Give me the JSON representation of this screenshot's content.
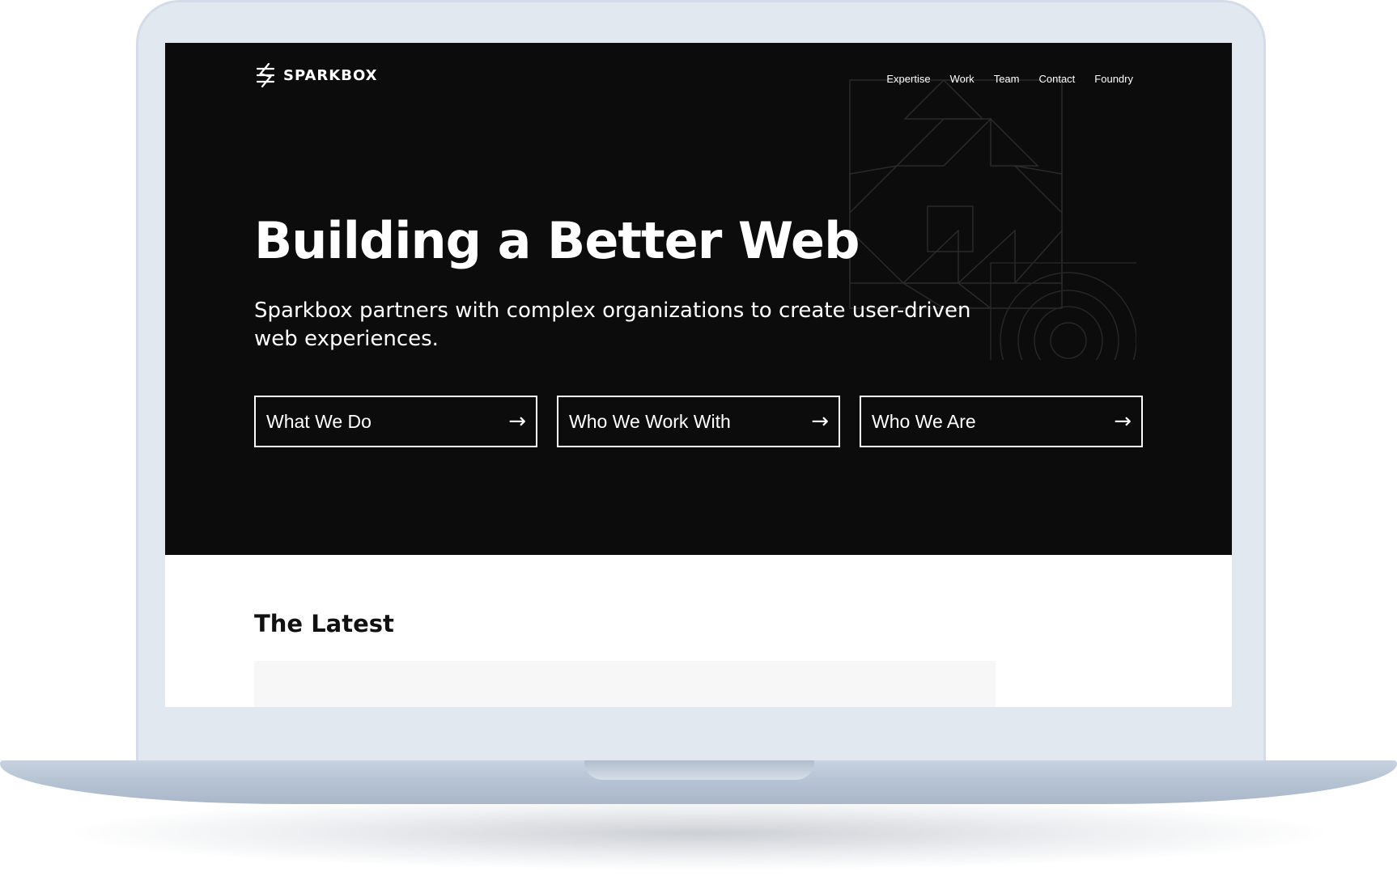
{
  "brand": {
    "name": "SPARKBOX",
    "logo_icon": "sparkbox-logo-icon"
  },
  "nav": {
    "items": [
      {
        "label": "Expertise"
      },
      {
        "label": "Work"
      },
      {
        "label": "Team"
      },
      {
        "label": "Contact"
      },
      {
        "label": "Foundry"
      }
    ]
  },
  "hero": {
    "headline": "Building a Better Web",
    "subhead": "Sparkbox partners with complex organizations to create user-driven web experiences.",
    "ctas": [
      {
        "label": "What We Do",
        "arrow": "→"
      },
      {
        "label": "Who We Work With",
        "arrow": "→"
      },
      {
        "label": "Who We Are",
        "arrow": "→"
      }
    ],
    "background_color": "#0c0c0c",
    "text_color": "#ffffff"
  },
  "latest": {
    "heading": "The Latest"
  },
  "device": {
    "frame_color": "#e1e8f0",
    "base_color": "#b8c5d5"
  }
}
